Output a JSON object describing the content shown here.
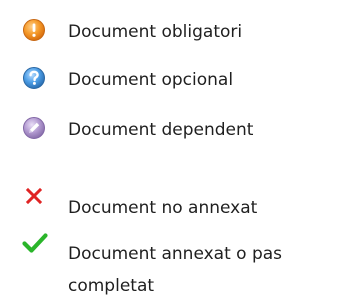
{
  "legend": {
    "items": [
      {
        "icon": "exclamation-icon",
        "color": "#f08a24",
        "label": "Document obligatori"
      },
      {
        "icon": "question-icon",
        "color": "#3d8fd6",
        "label": "Document opcional"
      },
      {
        "icon": "pencil-disabled-icon",
        "color": "#a993c7",
        "label": "Document dependent"
      },
      {
        "icon": "cross-icon",
        "color": "#e02424",
        "label": "Document no annexat"
      },
      {
        "icon": "checkmark-icon",
        "color": "#2ab52a",
        "label": "Document annexat o pas completat"
      }
    ]
  }
}
